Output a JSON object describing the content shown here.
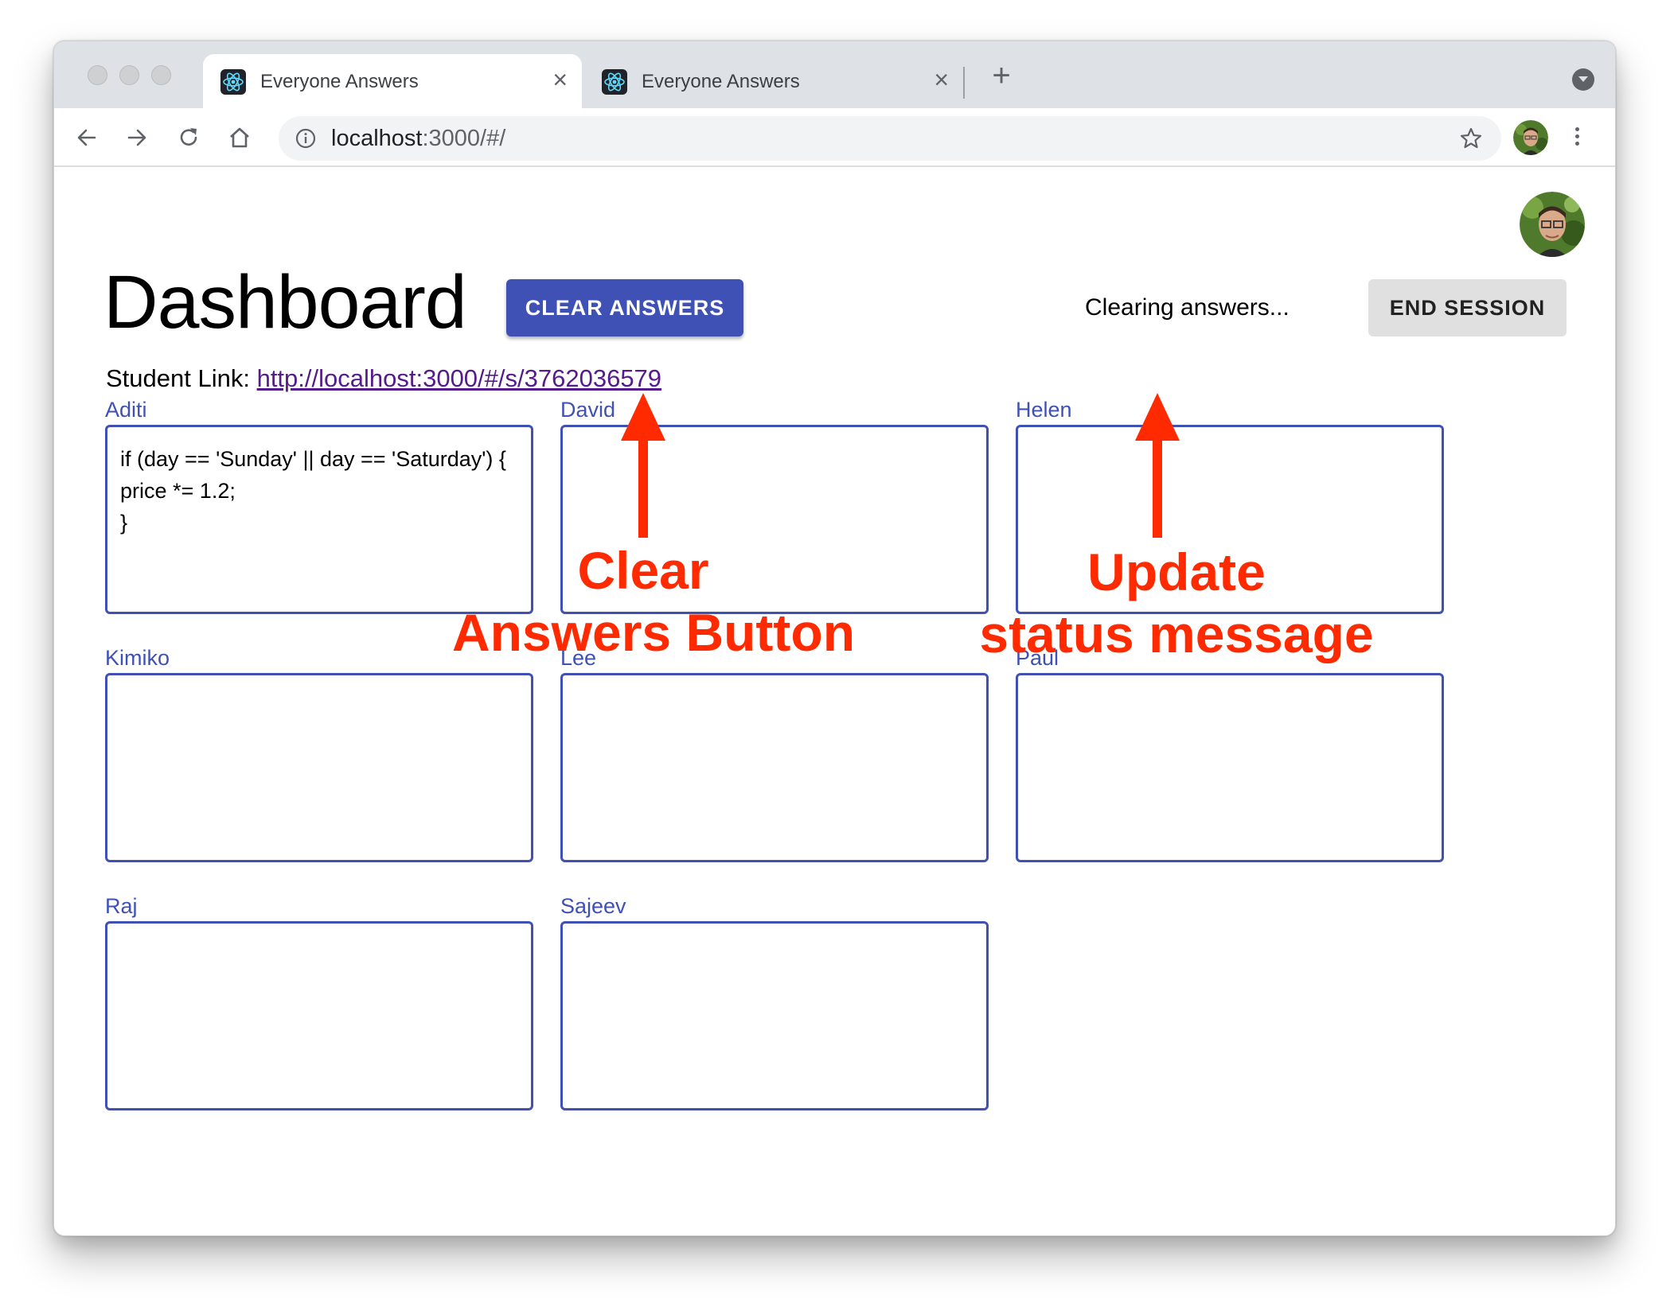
{
  "browser": {
    "tabs": [
      {
        "title": "Everyone Answers",
        "active": true
      },
      {
        "title": "Everyone Answers",
        "active": false
      }
    ],
    "address": {
      "host": "localhost",
      "rest": ":3000/#/"
    }
  },
  "dashboard": {
    "title": "Dashboard",
    "clear_button": "CLEAR ANSWERS",
    "status": "Clearing answers...",
    "end_button": "END SESSION",
    "student_link_label": "Student Link: ",
    "student_link_url": "http://localhost:3000/#/s/3762036579"
  },
  "students": [
    {
      "name": "Aditi",
      "answer": "if (day == 'Sunday' || day == 'Saturday') {\nprice *= 1.2;\n}"
    },
    {
      "name": "David",
      "answer": ""
    },
    {
      "name": "Helen",
      "answer": ""
    },
    {
      "name": "Kimiko",
      "answer": ""
    },
    {
      "name": "Lee",
      "answer": ""
    },
    {
      "name": "Paul",
      "answer": ""
    },
    {
      "name": "Raj",
      "answer": ""
    },
    {
      "name": "Sajeev",
      "answer": ""
    }
  ],
  "annotations": {
    "clear_line1": "Clear",
    "clear_line2": "Answers Button",
    "status_line1": "Update",
    "status_line2": "status message"
  },
  "colors": {
    "primary": "#3f51b5",
    "annotation": "#ff2a00",
    "link_visited": "#551a8b"
  }
}
